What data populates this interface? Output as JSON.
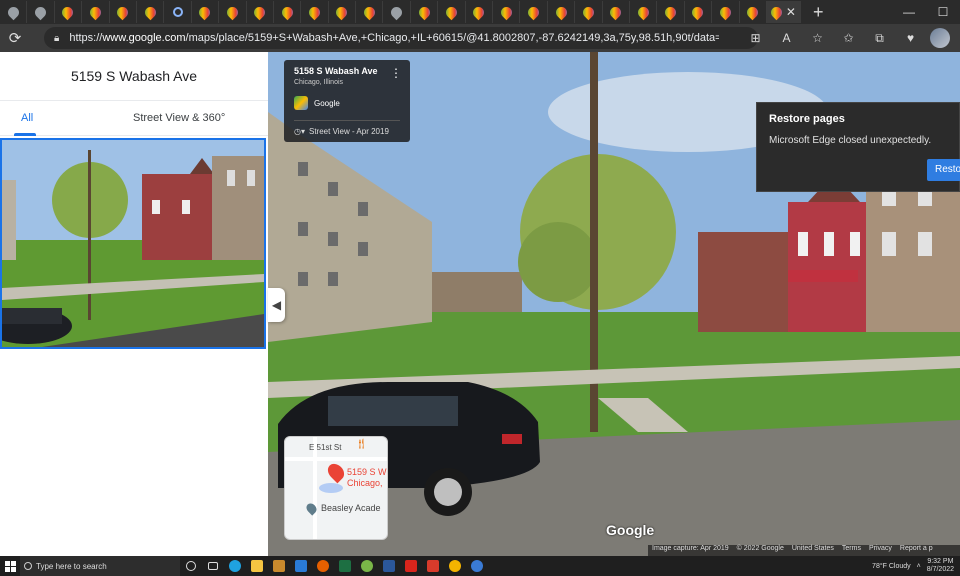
{
  "browser": {
    "url_prefix": "https://",
    "url_host": "www.google.com",
    "url_path": "/maps/place/5159+S+Wabash+Ave,+Chicago,+IL+60615/@41.8002807,-87.6242149,3a,75y,98.51h,90t/data=!3m7!1e...",
    "new_tab_label": "+",
    "tab_close": "✕"
  },
  "window_controls": {
    "minimize": "—",
    "maximize": "☐"
  },
  "sidebar": {
    "title": "5159 S Wabash Ave",
    "tabs": [
      {
        "label": "All"
      },
      {
        "label": "Street View & 360°"
      }
    ]
  },
  "streetview_card": {
    "address": "5158 S Wabash Ave",
    "city": "Chicago, Illinois",
    "provider": "Google",
    "history_label": "Street View - Apr 2019"
  },
  "restore_popup": {
    "title": "Restore pages",
    "message": "Microsoft Edge closed unexpectedly.",
    "button": "Resto"
  },
  "minimap": {
    "street": "E 51st St",
    "place_line1": "5159 S W",
    "place_line2": "Chicago,",
    "poi": "Beasley Acade"
  },
  "footer": {
    "watermark": "Google",
    "capture": "Image capture: Apr 2019",
    "copyright": "© 2022 Google",
    "links": [
      "United States",
      "Terms",
      "Privacy",
      "Report a p"
    ]
  },
  "taskbar": {
    "search_placeholder": "Type here to search",
    "weather": "78°F  Cloudy",
    "time": "9:32 PM",
    "date": "8/7/2022"
  },
  "colors": {
    "accent": "#1a73e8",
    "edge_blue": "#2f7de1",
    "pin_red": "#ea4335"
  }
}
